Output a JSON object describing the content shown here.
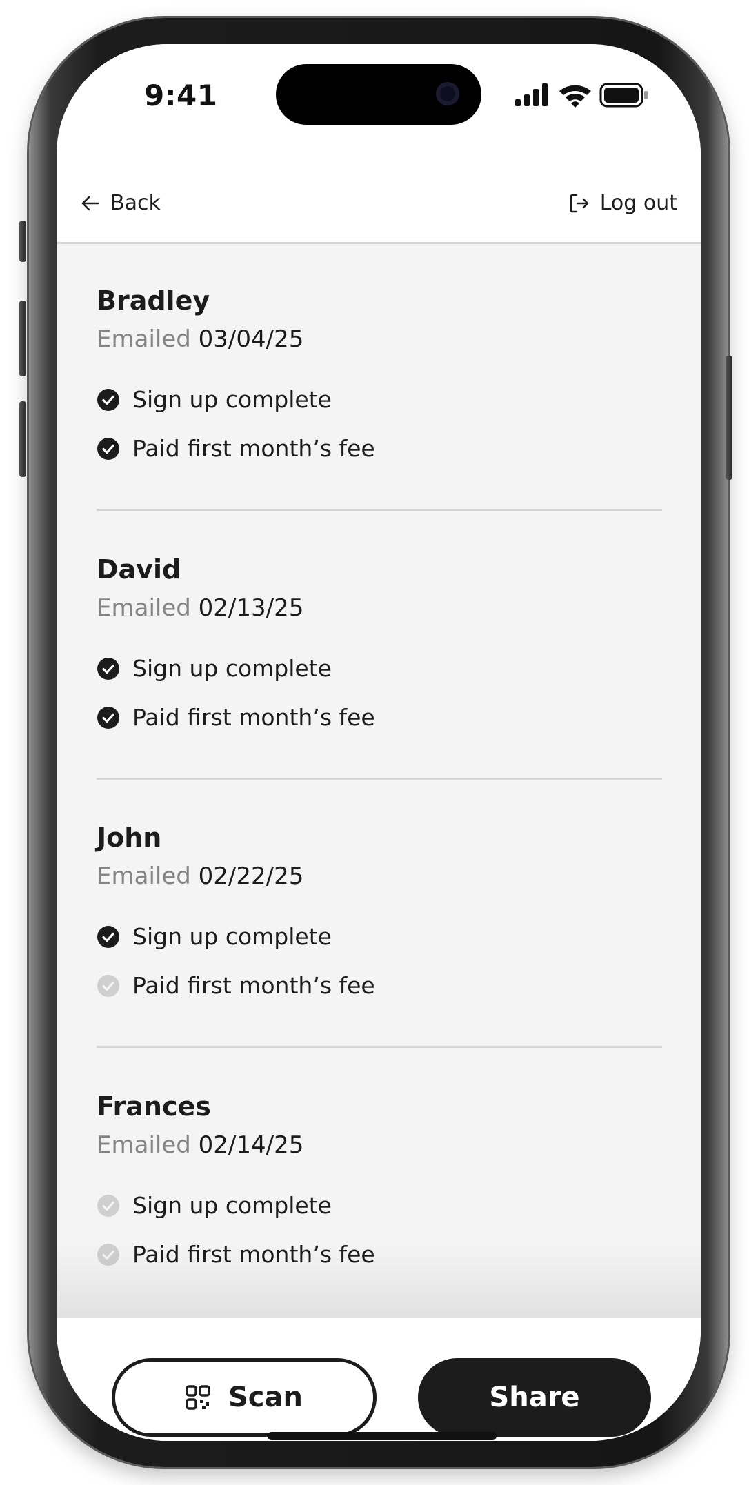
{
  "status_bar": {
    "time": "9:41"
  },
  "nav": {
    "back_label": "Back",
    "logout_label": "Log out"
  },
  "contacts": [
    {
      "name": "Bradley",
      "emailed_label": "Emailed",
      "emailed_date": "03/04/25",
      "items": [
        {
          "label": "Sign up complete",
          "done": true
        },
        {
          "label": "Paid first month’s fee",
          "done": true
        }
      ]
    },
    {
      "name": "David",
      "emailed_label": "Emailed",
      "emailed_date": "02/13/25",
      "items": [
        {
          "label": "Sign up complete",
          "done": true
        },
        {
          "label": "Paid first month’s fee",
          "done": true
        }
      ]
    },
    {
      "name": "John",
      "emailed_label": "Emailed",
      "emailed_date": "02/22/25",
      "items": [
        {
          "label": "Sign up complete",
          "done": true
        },
        {
          "label": "Paid first month’s fee",
          "done": false
        }
      ]
    },
    {
      "name": "Frances",
      "emailed_label": "Emailed",
      "emailed_date": "02/14/25",
      "items": [
        {
          "label": "Sign up complete",
          "done": false
        },
        {
          "label": "Paid first month’s fee",
          "done": false
        }
      ]
    }
  ],
  "actions": {
    "scan_label": "Scan",
    "share_label": "Share"
  },
  "colors": {
    "check_done": "#1c1c1c",
    "check_pending": "#cfcfcf",
    "content_bg": "#f4f4f4",
    "button_dark": "#1c1c1c"
  },
  "icons": {
    "back": "arrow-left-icon",
    "logout": "log-out-icon",
    "check": "check-circle-icon",
    "scan": "qr-code-icon"
  }
}
